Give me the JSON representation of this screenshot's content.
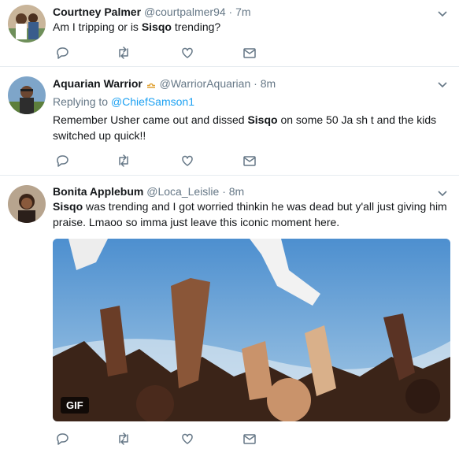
{
  "tweets": [
    {
      "name": "Courtney Palmer",
      "handle": "@courtpalmer94",
      "dot": "·",
      "time": "7m",
      "text_pre": "Am I tripping or is ",
      "text_bold": "Sisqo",
      "text_post": " trending?"
    },
    {
      "name": "Aquarian Warrior",
      "handle": "@WarriorAquarian",
      "dot": "·",
      "time": "8m",
      "emoji": "libra-sign",
      "reply_prefix": "Replying to ",
      "reply_target": "@ChiefSamson1",
      "text_pre": "Remember Usher came out and dissed ",
      "text_bold": "Sisqo",
      "text_post": " on some 50 Ja sh  t and the kids switched up quick!!"
    },
    {
      "name": "Bonita Applebum",
      "handle": "@Loca_Leislie",
      "dot": "·",
      "time": "8m",
      "text_bold": "Sisqo",
      "text_post": " was trending and I got worried thinkin he was dead but y'all just giving him praise. Lmaoo so imma just leave this iconic moment here.",
      "media_badge": "GIF"
    }
  ],
  "icons": {
    "reply": "reply-icon",
    "retweet": "retweet-icon",
    "like": "heart-icon",
    "message": "envelope-icon",
    "menu": "chevron-down-icon"
  },
  "colors": {
    "accent": "#1da1f2",
    "muted": "#657786",
    "divider": "#e6ecf0"
  }
}
